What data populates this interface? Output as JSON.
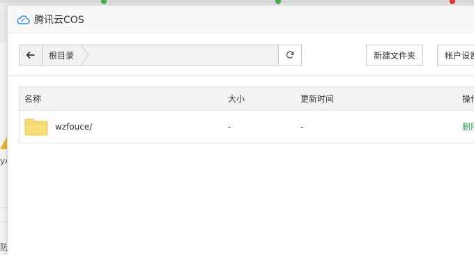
{
  "window": {
    "title": "腾讯云COS"
  },
  "toolbar": {
    "crumbs": [
      "根目录"
    ],
    "new_folder_label": "新建文件夹",
    "account_settings_label": "帐户设置"
  },
  "table": {
    "headers": {
      "name": "名称",
      "size": "大小",
      "modified": "更新时间",
      "actions": "操作"
    },
    "rows": [
      {
        "name": "wzfouce/",
        "size": "-",
        "modified": "-",
        "action": "删除",
        "icon": "folder-icon"
      }
    ]
  },
  "background": {
    "fragment_1": "yA",
    "fragment_2": "防"
  },
  "colors": {
    "accent_green": "#3aa35a",
    "folder": "#f7dc79",
    "cloud_icon": "#3a8fe0"
  },
  "icons": [
    "cloud-logo-icon",
    "arrow-left-icon",
    "refresh-icon",
    "folder-icon"
  ]
}
